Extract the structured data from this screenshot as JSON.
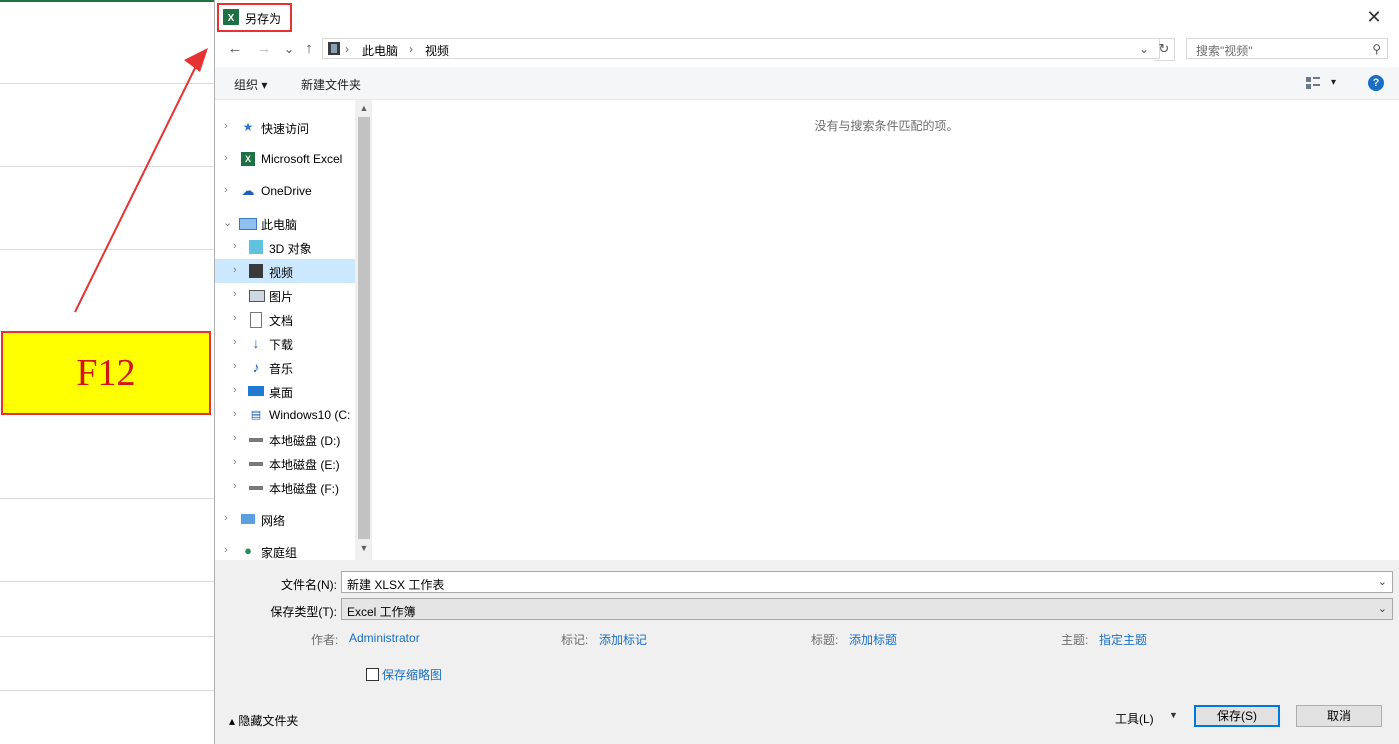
{
  "annotation": {
    "key_label": "F12"
  },
  "dialog": {
    "title": "另存为",
    "close": "✕"
  },
  "nav": {
    "back": "←",
    "forward": "→",
    "recent": "⌄",
    "up": "↑",
    "breadcrumbs": [
      "此电脑",
      "视频"
    ],
    "refresh": "↻",
    "search_placeholder": "搜索\"视频\""
  },
  "toolbar": {
    "organize": "组织 ▾",
    "new_folder": "新建文件夹",
    "view": "▾",
    "help": "?"
  },
  "navpane": {
    "items": [
      {
        "label": "快速访问",
        "icon": "star-icon"
      },
      {
        "label": "Microsoft Excel",
        "icon": "excel-icon"
      },
      {
        "label": "OneDrive",
        "icon": "cloud-icon"
      },
      {
        "label": "此电脑",
        "icon": "computer-icon"
      },
      {
        "label": "3D 对象",
        "icon": "cube-icon"
      },
      {
        "label": "视频",
        "icon": "film-icon"
      },
      {
        "label": "图片",
        "icon": "picture-icon"
      },
      {
        "label": "文档",
        "icon": "document-icon"
      },
      {
        "label": "下载",
        "icon": "download-icon"
      },
      {
        "label": "音乐",
        "icon": "music-icon"
      },
      {
        "label": "桌面",
        "icon": "desktop-icon"
      },
      {
        "label": "Windows10 (C:",
        "icon": "os-drive-icon"
      },
      {
        "label": "本地磁盘 (D:)",
        "icon": "drive-icon"
      },
      {
        "label": "本地磁盘 (E:)",
        "icon": "drive-icon"
      },
      {
        "label": "本地磁盘 (F:)",
        "icon": "drive-icon"
      },
      {
        "label": "网络",
        "icon": "network-icon"
      },
      {
        "label": "家庭组",
        "icon": "homegroup-icon"
      }
    ],
    "selected": "视频"
  },
  "content": {
    "empty_message": "没有与搜索条件匹配的项。"
  },
  "form": {
    "filename_label": "文件名(N):",
    "filename_value": "新建 XLSX 工作表",
    "type_label": "保存类型(T):",
    "type_value": "Excel 工作簿",
    "author_label": "作者:",
    "author_value": "Administrator",
    "tags_label": "标记:",
    "tags_value": "添加标记",
    "title_label": "标题:",
    "title_value": "添加标题",
    "subject_label": "主题:",
    "subject_value": "指定主题",
    "thumbnail_label": "保存缩略图",
    "hide_folders": "隐藏文件夹",
    "tools": "工具(L)",
    "save": "保存(S)",
    "cancel": "取消"
  },
  "colors": {
    "accent": "#0078d7",
    "link": "#1a6ec6",
    "highlight_border": "#e53333",
    "key_bg": "#ffff00"
  }
}
